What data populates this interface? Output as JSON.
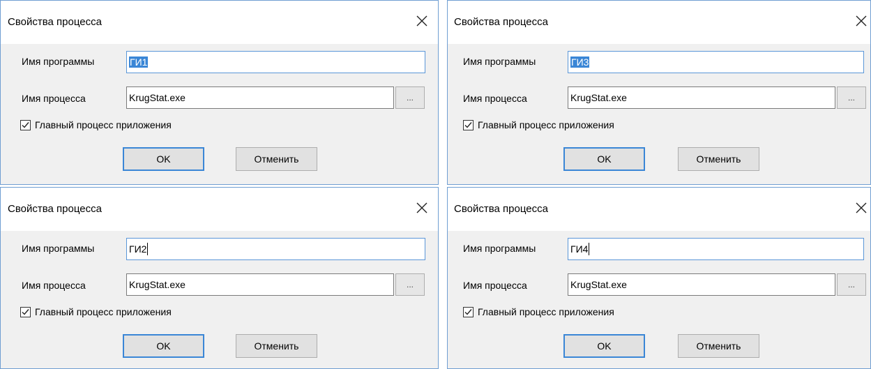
{
  "dialogs": [
    {
      "title": "Свойства процесса",
      "program_label": "Имя программы",
      "program_value": "ГИ1",
      "program_selected": true,
      "process_label": "Имя процесса",
      "process_value": "KrugStat.exe",
      "browse_label": "...",
      "main_process_label": "Главный процесс приложения",
      "main_process_checked": true,
      "ok_label": "OK",
      "cancel_label": "Отменить"
    },
    {
      "title": "Свойства процесса",
      "program_label": "Имя программы",
      "program_value": "ГИ3",
      "program_selected": true,
      "process_label": "Имя процесса",
      "process_value": "KrugStat.exe",
      "browse_label": "...",
      "main_process_label": "Главный процесс приложения",
      "main_process_checked": true,
      "ok_label": "OK",
      "cancel_label": "Отменить"
    },
    {
      "title": "Свойства процесса",
      "program_label": "Имя программы",
      "program_value": "ГИ2",
      "program_selected": false,
      "process_label": "Имя процесса",
      "process_value": "KrugStat.exe",
      "browse_label": "...",
      "main_process_label": "Главный процесс приложения",
      "main_process_checked": true,
      "ok_label": "OK",
      "cancel_label": "Отменить"
    },
    {
      "title": "Свойства процесса",
      "program_label": "Имя программы",
      "program_value": "ГИ4",
      "program_selected": false,
      "process_label": "Имя процесса",
      "process_value": "KrugStat.exe",
      "browse_label": "...",
      "main_process_label": "Главный процесс приложения",
      "main_process_checked": true,
      "ok_label": "OK",
      "cancel_label": "Отменить"
    }
  ],
  "colors": {
    "dialog_border": "#6f9ed2",
    "selection": "#3a86d6",
    "dialog_bg": "#f0f0f0"
  },
  "icons": {
    "close": "close-icon",
    "checkmark": "checkmark-icon"
  }
}
